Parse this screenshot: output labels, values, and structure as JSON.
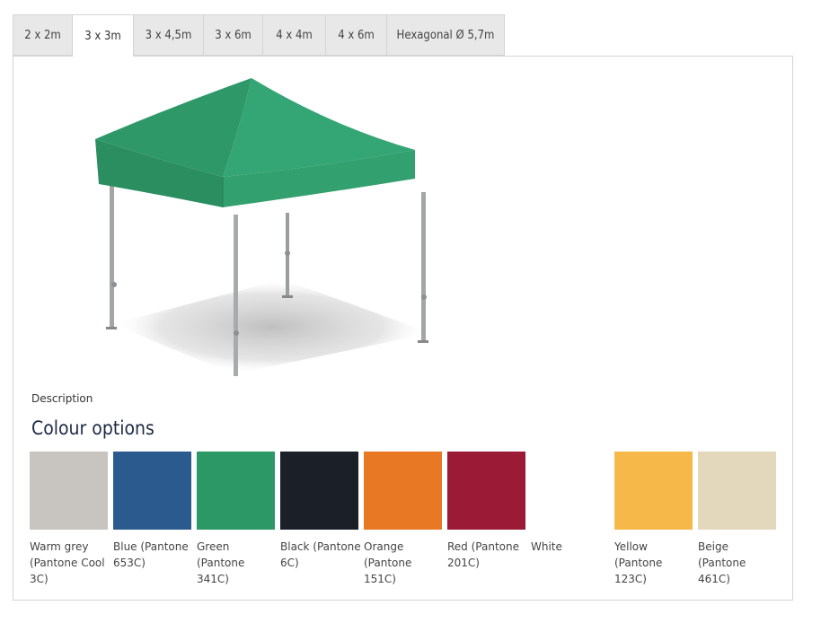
{
  "tabs": [
    {
      "label": "2 x 2m",
      "active": false
    },
    {
      "label": "3 x 3m",
      "active": true
    },
    {
      "label": "3 x 4,5m",
      "active": false
    },
    {
      "label": "3 x 6m",
      "active": false
    },
    {
      "label": "4 x 4m",
      "active": false
    },
    {
      "label": "4 x 6m",
      "active": false
    },
    {
      "label": "Hexagonal Ø 5,7m",
      "active": false
    }
  ],
  "product_image": {
    "icon": "green-canopy-tent-image",
    "canopy_color": "#2e9a6c"
  },
  "description_link": "Description",
  "colour_options": {
    "heading": "Colour options",
    "items": [
      {
        "label": "Warm grey (Pantone Cool 3C)",
        "color": "#c8c4bf"
      },
      {
        "label": "Blue (Pantone 653C)",
        "color": "#2b5a8e"
      },
      {
        "label": "Green (Pantone 341C)",
        "color": "#2c9866"
      },
      {
        "label": "Black (Pantone 6C)",
        "color": "#1b2028"
      },
      {
        "label": "Orange (Pantone 151C)",
        "color": "#e87824"
      },
      {
        "label": "Red (Pantone 201C)",
        "color": "#9b1a36"
      },
      {
        "label": "White",
        "color": "#ffffff"
      },
      {
        "label": "Yellow (Pantone 123C)",
        "color": "#f7b84a"
      },
      {
        "label": "Beige (Pantone 461C)",
        "color": "#e3d8bb"
      }
    ]
  }
}
